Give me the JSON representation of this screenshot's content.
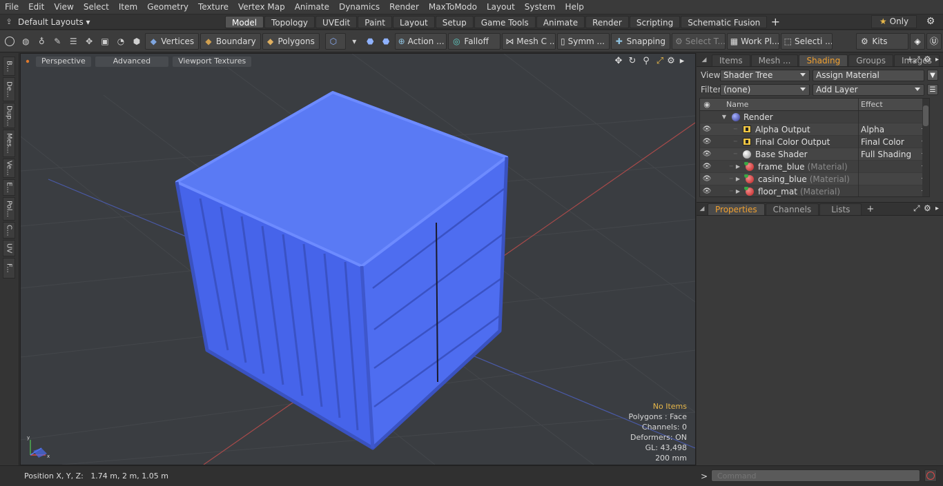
{
  "menu": [
    "File",
    "Edit",
    "View",
    "Select",
    "Item",
    "Geometry",
    "Texture",
    "Vertex Map",
    "Animate",
    "Dynamics",
    "Render",
    "MaxToModo",
    "Layout",
    "System",
    "Help"
  ],
  "layouts": {
    "current": "Default Layouts ▾",
    "tabs": [
      "Model",
      "Topology",
      "UVEdit",
      "Paint",
      "Layout",
      "Setup",
      "Game Tools",
      "Animate",
      "Render",
      "Scripting",
      "Schematic Fusion"
    ],
    "active_tab": "Model",
    "plus": "+",
    "only_label": "Only",
    "star": "★"
  },
  "toolbar": {
    "vertices": "Vertices",
    "boundary": "Boundary",
    "polygons": "Polygons",
    "action": "Action ...",
    "falloff": "Falloff",
    "mesh_c": "Mesh C ...",
    "symm": "Symm ...",
    "snapping": "Snapping",
    "select_t": "Select T...",
    "work_pl": "Work Pl...",
    "selecti": "Selecti ...",
    "kits": "Kits"
  },
  "side_tabs": [
    "B...",
    "De...",
    "Dup...",
    "Mes...",
    "Ve...",
    "E...",
    "Pol...",
    "C...",
    "UV",
    "F..."
  ],
  "viewport": {
    "tabs": [
      "Perspective",
      "Advanced",
      "Viewport Textures"
    ],
    "info": {
      "status": "No Items",
      "polygons": "Polygons : Face",
      "channels": "Channels: 0",
      "deformers": "Deformers: ON",
      "gl": "GL: 43,498",
      "scale": "200 mm"
    },
    "axis_y": "y",
    "axis_x": "x",
    "colors": {
      "container": "#4a6cf0",
      "background": "#3a3d41"
    }
  },
  "right_panel": {
    "tabs": [
      "Items",
      "Mesh ...",
      "Shading",
      "Groups",
      "Images"
    ],
    "active_tab": "Shading",
    "view_label": "View",
    "view_value": "Shader Tree",
    "assign_material": "Assign Material",
    "filter_label": "Filter",
    "filter_value": "(none)",
    "add_layer": "Add Layer",
    "columns": {
      "name": "Name",
      "effect": "Effect"
    },
    "tree": [
      {
        "name": "Render",
        "sub": "",
        "effect": "",
        "icon": "render"
      },
      {
        "name": "Alpha Output",
        "sub": "",
        "effect": "Alpha",
        "icon": "output"
      },
      {
        "name": "Final Color Output",
        "sub": "",
        "effect": "Final Color",
        "icon": "output"
      },
      {
        "name": "Base Shader",
        "sub": "",
        "effect": "Full Shading",
        "icon": "shader"
      },
      {
        "name": "frame_blue",
        "sub": "(Material)",
        "effect": "",
        "icon": "material"
      },
      {
        "name": "casing_blue",
        "sub": "(Material)",
        "effect": "",
        "icon": "material"
      },
      {
        "name": "floor_mat",
        "sub": "(Material)",
        "effect": "",
        "icon": "material"
      }
    ],
    "lower_tabs": [
      "Properties",
      "Channels",
      "Lists"
    ],
    "lower_active": "Properties"
  },
  "status": {
    "position_label": "Position X, Y, Z:",
    "position_value": "1.74 m, 2 m, 1.05 m",
    "command_placeholder": "Command"
  }
}
